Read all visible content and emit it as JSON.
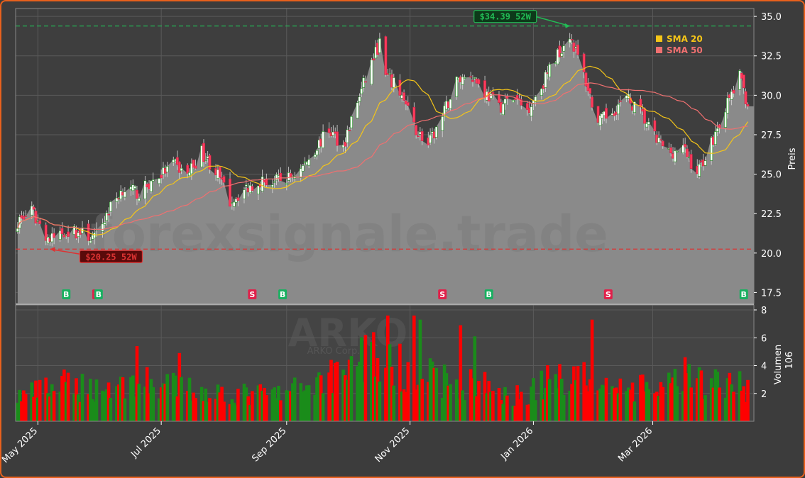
{
  "chart_data": {
    "type": "candlestick",
    "ticker": "ARKO",
    "company": "ARKO Corp.",
    "watermark": "forexsignale.trade",
    "colors": {
      "up": "#1a8c1a",
      "down": "#ff0000",
      "sma20": "#f5c518",
      "sma50": "#f07070",
      "high_line": "#22bb55",
      "low_line": "#dd3333",
      "area": "#8a8a8a",
      "buy": "#18b060",
      "sell": "#e0204a"
    },
    "price_axis": {
      "label": "Preis",
      "ylim": [
        16.8,
        35.5
      ],
      "ticks": [
        17.5,
        20.0,
        22.5,
        25.0,
        27.5,
        30.0,
        32.5,
        35.0
      ]
    },
    "volume_axis": {
      "label": "Volumen",
      "unit": "10^6",
      "ylim": [
        0,
        8.0
      ],
      "ticks": [
        2,
        4,
        6,
        8
      ]
    },
    "x_axis": {
      "start": "2025-04-20",
      "end": "2026-04-20",
      "ticks": [
        {
          "date": "2025-05-01",
          "label": "May 2025"
        },
        {
          "date": "2025-07-01",
          "label": "Jul 2025"
        },
        {
          "date": "2025-09-01",
          "label": "Sep 2025"
        },
        {
          "date": "2025-11-01",
          "label": "Nov 2025"
        },
        {
          "date": "2026-01-01",
          "label": "Jan 2026"
        },
        {
          "date": "2026-03-01",
          "label": "Mar 2026"
        }
      ]
    },
    "legend": [
      {
        "label": "SMA 20",
        "color": "#f5c518"
      },
      {
        "label": "SMA 50",
        "color": "#f07070"
      }
    ],
    "annotations": [
      {
        "label": "$34.39 52W",
        "value": 34.39,
        "date": "2026-01-19",
        "kind": "high"
      },
      {
        "label": "$20.25 52W",
        "value": 20.25,
        "date": "2025-05-07",
        "kind": "low"
      }
    ],
    "signals": [
      {
        "date": "2025-05-15",
        "label": "B"
      },
      {
        "date": "2025-05-30",
        "label": "S"
      },
      {
        "date": "2025-05-31",
        "label": "B"
      },
      {
        "date": "2025-08-15",
        "label": "S"
      },
      {
        "date": "2025-08-30",
        "label": "B"
      },
      {
        "date": "2025-11-17",
        "label": "S"
      },
      {
        "date": "2025-12-10",
        "label": "B"
      },
      {
        "date": "2026-02-07",
        "label": "S"
      },
      {
        "date": "2026-04-15",
        "label": "B"
      }
    ],
    "price_anchors": [
      [
        "2025-04-21",
        22.0
      ],
      [
        "2025-04-28",
        22.6
      ],
      [
        "2025-05-07",
        20.8
      ],
      [
        "2025-05-14",
        21.4
      ],
      [
        "2025-05-22",
        21.3
      ],
      [
        "2025-05-29",
        20.9
      ],
      [
        "2025-06-05",
        22.7
      ],
      [
        "2025-06-12",
        24.1
      ],
      [
        "2025-06-20",
        23.8
      ],
      [
        "2025-06-27",
        24.6
      ],
      [
        "2025-07-07",
        25.6
      ],
      [
        "2025-07-14",
        25.0
      ],
      [
        "2025-07-21",
        26.4
      ],
      [
        "2025-07-28",
        25.2
      ],
      [
        "2025-08-04",
        23.3
      ],
      [
        "2025-08-11",
        24.0
      ],
      [
        "2025-08-18",
        24.6
      ],
      [
        "2025-08-25",
        24.5
      ],
      [
        "2025-09-01",
        24.7
      ],
      [
        "2025-09-08",
        25.3
      ],
      [
        "2025-09-15",
        26.6
      ],
      [
        "2025-09-22",
        27.8
      ],
      [
        "2025-09-29",
        26.8
      ],
      [
        "2025-10-06",
        29.6
      ],
      [
        "2025-10-13",
        32.1
      ],
      [
        "2025-10-17",
        33.3
      ],
      [
        "2025-10-20",
        31.2
      ],
      [
        "2025-10-27",
        30.3
      ],
      [
        "2025-11-03",
        28.0
      ],
      [
        "2025-11-10",
        26.8
      ],
      [
        "2025-11-17",
        28.6
      ],
      [
        "2025-11-24",
        30.9
      ],
      [
        "2025-12-01",
        31.4
      ],
      [
        "2025-12-08",
        30.2
      ],
      [
        "2025-12-15",
        29.3
      ],
      [
        "2025-12-22",
        29.8
      ],
      [
        "2025-12-29",
        29.1
      ],
      [
        "2026-01-05",
        30.6
      ],
      [
        "2026-01-12",
        32.4
      ],
      [
        "2026-01-19",
        33.9
      ],
      [
        "2026-01-26",
        31.3
      ],
      [
        "2026-02-02",
        28.2
      ],
      [
        "2026-02-09",
        29.0
      ],
      [
        "2026-02-16",
        29.8
      ],
      [
        "2026-02-23",
        28.9
      ],
      [
        "2026-03-02",
        27.3
      ],
      [
        "2026-03-09",
        26.4
      ],
      [
        "2026-03-16",
        26.6
      ],
      [
        "2026-03-23",
        25.1
      ],
      [
        "2026-03-30",
        27.0
      ],
      [
        "2026-04-06",
        29.2
      ],
      [
        "2026-04-13",
        31.2
      ],
      [
        "2026-04-17",
        29.4
      ]
    ],
    "volume_anchors": [
      [
        "2025-04-21",
        1.8
      ],
      [
        "2025-05-15",
        2.6
      ],
      [
        "2025-06-01",
        2.4
      ],
      [
        "2025-06-20",
        2.8
      ],
      [
        "2025-07-15",
        2.3
      ],
      [
        "2025-08-10",
        1.9
      ],
      [
        "2025-09-01",
        2.0
      ],
      [
        "2025-09-20",
        3.2
      ],
      [
        "2025-10-10",
        4.8
      ],
      [
        "2025-10-20",
        4.2
      ],
      [
        "2025-11-05",
        3.4
      ],
      [
        "2025-11-20",
        2.9
      ],
      [
        "2025-12-10",
        2.5
      ],
      [
        "2025-12-25",
        1.8
      ],
      [
        "2026-01-10",
        3.0
      ],
      [
        "2026-01-25",
        3.6
      ],
      [
        "2026-02-10",
        2.4
      ],
      [
        "2026-03-01",
        2.3
      ],
      [
        "2026-03-20",
        2.9
      ],
      [
        "2026-04-17",
        2.5
      ]
    ],
    "volume_spikes": [
      [
        "2025-10-21",
        7.6
      ],
      [
        "2025-11-03",
        7.6
      ],
      [
        "2025-11-06",
        7.3
      ],
      [
        "2025-11-26",
        6.9
      ],
      [
        "2026-01-30",
        7.3
      ],
      [
        "2025-10-14",
        6.4
      ],
      [
        "2025-10-10",
        6.2
      ],
      [
        "2025-06-19",
        5.4
      ],
      [
        "2025-07-10",
        4.9
      ],
      [
        "2025-12-03",
        6.1
      ],
      [
        "2026-03-14",
        4.7
      ],
      [
        "2026-03-17",
        4.6
      ]
    ]
  }
}
